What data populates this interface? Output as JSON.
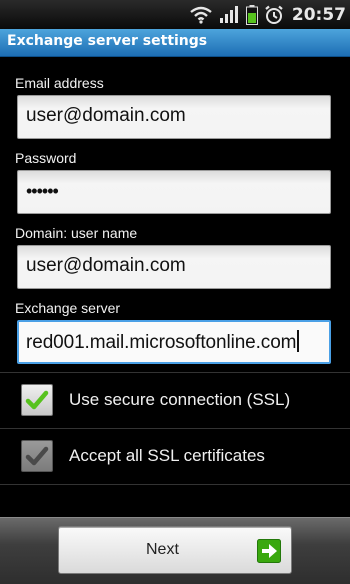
{
  "status_bar": {
    "time": "20:57",
    "icons": [
      "wifi-icon",
      "signal-icon",
      "battery-icon",
      "alarm-icon"
    ]
  },
  "title_bar": {
    "title": "Exchange server settings"
  },
  "form": {
    "email": {
      "label": "Email address",
      "value": "user@domain.com"
    },
    "password": {
      "label": "Password",
      "value": "••••••"
    },
    "domain_user": {
      "label": "Domain: user name",
      "value": "user@domain.com"
    },
    "exchange_server": {
      "label": "Exchange server",
      "value": "red001.mail.microsoftonline.com"
    }
  },
  "options": {
    "ssl": {
      "label": "Use secure connection (SSL)",
      "checked": true,
      "enabled": true
    },
    "accept_all": {
      "label": "Accept all SSL certificates",
      "checked": true,
      "enabled": false
    }
  },
  "footer": {
    "next_label": "Next"
  },
  "colors": {
    "accent_blue": "#2a7fc6",
    "check_green": "#57c21e",
    "arrow_green": "#3aa80e"
  }
}
